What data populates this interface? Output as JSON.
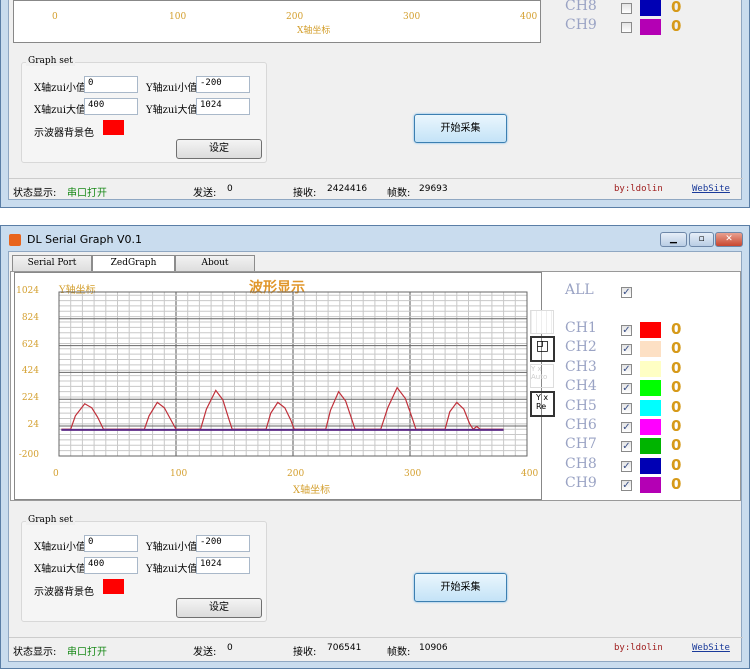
{
  "app": {
    "title": "DL Serial Graph V0.1",
    "tabs": [
      "Serial Port",
      "ZedGraph",
      "About"
    ],
    "active_tab": "ZedGraph"
  },
  "graph": {
    "title": "波形显示",
    "ylabel": "Y轴坐标",
    "xlabel": "X轴坐标"
  },
  "channels": {
    "all_label": "ALL",
    "all_checked": true,
    "items": [
      {
        "name": "CH1",
        "color": "#ff0000",
        "value": "0"
      },
      {
        "name": "CH2",
        "color": "#fde0c4",
        "value": "0"
      },
      {
        "name": "CH3",
        "color": "#ffffc4",
        "value": "0"
      },
      {
        "name": "CH4",
        "color": "#00ff00",
        "value": "0"
      },
      {
        "name": "CH5",
        "color": "#00ffff",
        "value": "0"
      },
      {
        "name": "CH6",
        "color": "#ff00ff",
        "value": "0"
      },
      {
        "name": "CH7",
        "color": "#00b400",
        "value": "0"
      },
      {
        "name": "CH8",
        "color": "#0000b4",
        "value": "0"
      },
      {
        "name": "CH9",
        "color": "#b400b4",
        "value": "0"
      }
    ]
  },
  "graph_set": {
    "legend": "Graph set",
    "xmin_label": "X轴zui小值",
    "xmin": "0",
    "ymin_label": "Y轴zui小值",
    "ymin": "-200",
    "xmax_label": "X轴zui大值",
    "xmax": "400",
    "ymax_label": "Y轴zui大值",
    "ymax": "1024",
    "bg_label": "示波器背景色",
    "bg_color": "#ff0000",
    "set_button": "设定"
  },
  "start_button": "开始采集",
  "top_status": {
    "state_label": "状态显示:",
    "state": "串口打开",
    "send_label": "发送:",
    "send": "0",
    "recv_label": "接收:",
    "recv": "2424416",
    "frames_label": "帧数:",
    "frames": "29693",
    "author": "by:ldolin",
    "website": "WebSite"
  },
  "status": {
    "state_label": "状态显示:",
    "state": "串口打开",
    "send_label": "发送:",
    "send": "0",
    "recv_label": "接收:",
    "recv": "706541",
    "frames_label": "帧数:",
    "frames": "10906",
    "author": "by:ldolin",
    "website": "WebSite"
  },
  "chart_data": {
    "type": "line",
    "title": "波形显示",
    "xlabel": "X轴坐标",
    "ylabel": "Y轴坐标",
    "xlim": [
      0,
      400
    ],
    "ylim": [
      -200,
      1024
    ],
    "xticks": [
      "0",
      "100",
      "200",
      "300",
      "400"
    ],
    "yticks": [
      "1024",
      "824",
      "624",
      "424",
      "224",
      "24",
      "-200"
    ],
    "grid": true,
    "series": [
      {
        "color": "#c0303a",
        "points": [
          [
            2,
            0
          ],
          [
            10,
            0
          ],
          [
            14,
            100
          ],
          [
            22,
            190
          ],
          [
            28,
            160
          ],
          [
            33,
            90
          ],
          [
            38,
            0
          ],
          [
            73,
            0
          ],
          [
            77,
            100
          ],
          [
            84,
            200
          ],
          [
            90,
            160
          ],
          [
            95,
            80
          ],
          [
            100,
            0
          ],
          [
            121,
            0
          ],
          [
            126,
            150
          ],
          [
            134,
            290
          ],
          [
            140,
            220
          ],
          [
            145,
            80
          ],
          [
            148,
            0
          ],
          [
            177,
            0
          ],
          [
            181,
            120
          ],
          [
            187,
            200
          ],
          [
            193,
            160
          ],
          [
            198,
            70
          ],
          [
            201,
            0
          ],
          [
            228,
            0
          ],
          [
            232,
            140
          ],
          [
            239,
            280
          ],
          [
            245,
            210
          ],
          [
            250,
            80
          ],
          [
            253,
            0
          ],
          [
            275,
            0
          ],
          [
            281,
            160
          ],
          [
            289,
            310
          ],
          [
            296,
            230
          ],
          [
            302,
            80
          ],
          [
            305,
            0
          ],
          [
            330,
            0
          ],
          [
            334,
            130
          ],
          [
            340,
            200
          ],
          [
            346,
            150
          ],
          [
            351,
            40
          ],
          [
            354,
            0
          ],
          [
            357,
            20
          ],
          [
            360,
            0
          ],
          [
            380,
            0
          ]
        ]
      },
      {
        "color": "#5b2a86",
        "points": [
          [
            2,
            -5
          ],
          [
            380,
            -5
          ]
        ]
      }
    ]
  }
}
